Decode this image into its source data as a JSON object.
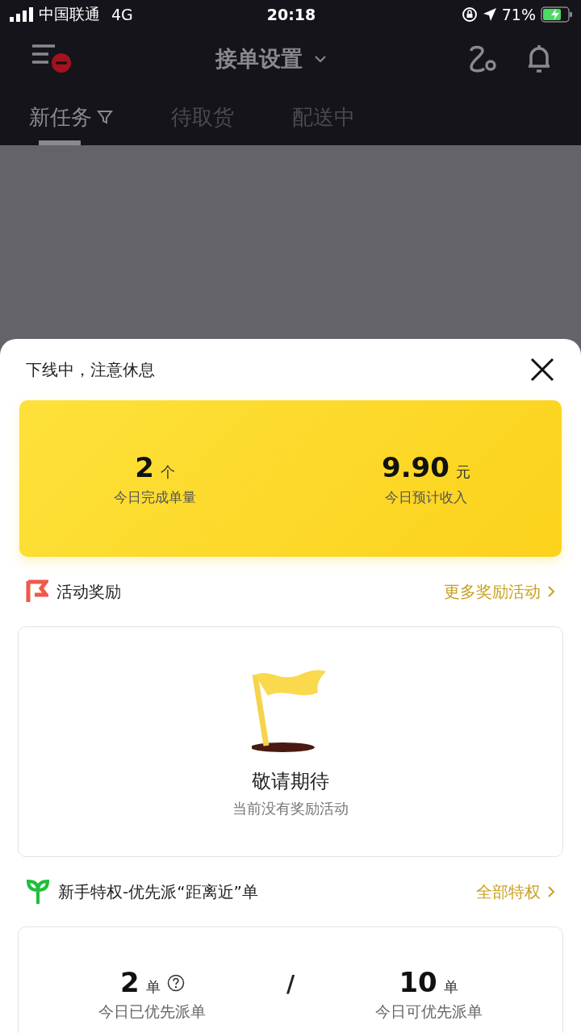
{
  "status_bar": {
    "carrier": "中国联通",
    "network": "4G",
    "time": "20:18",
    "battery": "71%"
  },
  "header": {
    "title": "接单设置"
  },
  "tabs": [
    {
      "label": "新任务",
      "selected": true,
      "filter": true
    },
    {
      "label": "待取货",
      "selected": false,
      "filter": false
    },
    {
      "label": "配送中",
      "selected": false,
      "filter": false
    }
  ],
  "sheet": {
    "title": "下线中，注意休息",
    "summary": [
      {
        "value": "2",
        "unit": "个",
        "label": "今日完成单量"
      },
      {
        "value": "9.90",
        "unit": "元",
        "label": "今日预计收入"
      }
    ],
    "activity": {
      "title": "活动奖励",
      "link": "更多奖励活动",
      "empty_title": "敬请期待",
      "empty_text": "当前没有奖励活动"
    },
    "privilege": {
      "title": "新手特权-优先派“距离近”单",
      "link": "全部特权",
      "separator": "/",
      "stats": [
        {
          "value": "2",
          "unit": "单",
          "label": "今日已优先派单",
          "info": true
        },
        {
          "value": "10",
          "unit": "单",
          "label": "今日可优先派单",
          "info": false
        }
      ]
    }
  }
}
